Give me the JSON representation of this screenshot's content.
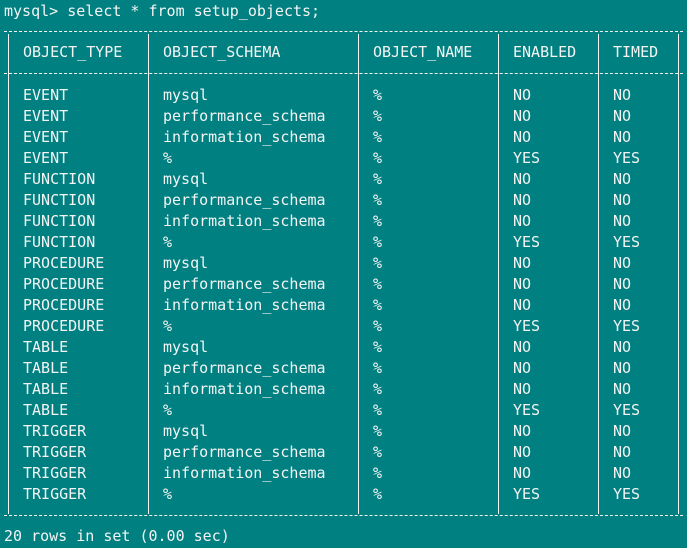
{
  "terminal": {
    "prompt": "mysql> select * from setup_objects;",
    "footer": "20 rows in set (0.00 sec)"
  },
  "table": {
    "columns": [
      "OBJECT_TYPE",
      "OBJECT_SCHEMA",
      "OBJECT_NAME",
      "ENABLED",
      "TIMED"
    ],
    "rows": [
      [
        "EVENT",
        "mysql",
        "%",
        "NO",
        "NO"
      ],
      [
        "EVENT",
        "performance_schema",
        "%",
        "NO",
        "NO"
      ],
      [
        "EVENT",
        "information_schema",
        "%",
        "NO",
        "NO"
      ],
      [
        "EVENT",
        "%",
        "%",
        "YES",
        "YES"
      ],
      [
        "FUNCTION",
        "mysql",
        "%",
        "NO",
        "NO"
      ],
      [
        "FUNCTION",
        "performance_schema",
        "%",
        "NO",
        "NO"
      ],
      [
        "FUNCTION",
        "information_schema",
        "%",
        "NO",
        "NO"
      ],
      [
        "FUNCTION",
        "%",
        "%",
        "YES",
        "YES"
      ],
      [
        "PROCEDURE",
        "mysql",
        "%",
        "NO",
        "NO"
      ],
      [
        "PROCEDURE",
        "performance_schema",
        "%",
        "NO",
        "NO"
      ],
      [
        "PROCEDURE",
        "information_schema",
        "%",
        "NO",
        "NO"
      ],
      [
        "PROCEDURE",
        "%",
        "%",
        "YES",
        "YES"
      ],
      [
        "TABLE",
        "mysql",
        "%",
        "NO",
        "NO"
      ],
      [
        "TABLE",
        "performance_schema",
        "%",
        "NO",
        "NO"
      ],
      [
        "TABLE",
        "information_schema",
        "%",
        "NO",
        "NO"
      ],
      [
        "TABLE",
        "%",
        "%",
        "YES",
        "YES"
      ],
      [
        "TRIGGER",
        "mysql",
        "%",
        "NO",
        "NO"
      ],
      [
        "TRIGGER",
        "performance_schema",
        "%",
        "NO",
        "NO"
      ],
      [
        "TRIGGER",
        "information_schema",
        "%",
        "NO",
        "NO"
      ],
      [
        "TRIGGER",
        "%",
        "%",
        "YES",
        "YES"
      ]
    ]
  },
  "colors": {
    "background": "#008080",
    "text": "#f4f4f4"
  }
}
